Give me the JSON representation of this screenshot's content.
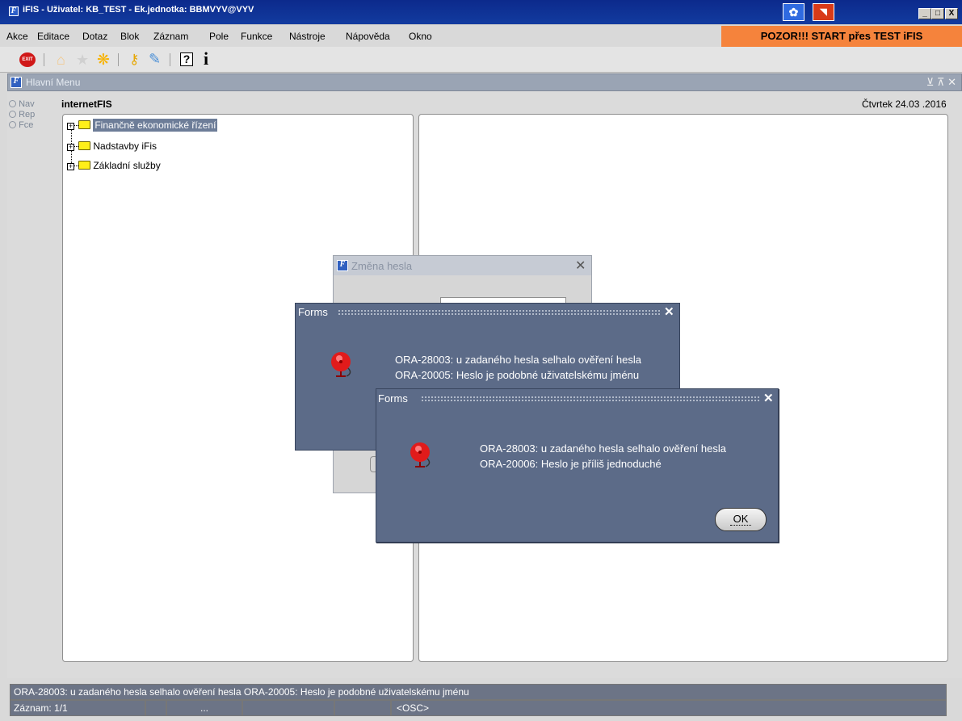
{
  "window": {
    "title": "iFIS - Uživatel: KB_TEST - Ek.jednotka: BBMVYV@VYV",
    "min": "_",
    "max": "□",
    "close": "X"
  },
  "menu": [
    "Akce",
    "Editace",
    "Dotaz",
    "Blok",
    "Záznam",
    "Pole",
    "Funkce",
    "Nástroje",
    "Nápověda",
    "Okno"
  ],
  "banner": "POZOR!!!  START přes TEST iFIS",
  "toolbar": {
    "exit_label": "EXIT",
    "help_glyph": "?",
    "info_glyph": "i"
  },
  "inner_window": {
    "title": "Hlavní Menu",
    "controls": "⊻ ⊼ ✕"
  },
  "radios": [
    "Nav",
    "Rep",
    "Fce"
  ],
  "app_name": "internetFIS",
  "date": "Čtvrtek 24.03 .2016",
  "tree": [
    "Finančně ekonomické řízení",
    "Nadstavby iFis",
    "Základní služby"
  ],
  "password_dialog": {
    "title": "Změna hesla",
    "close": "✕"
  },
  "dialog1": {
    "title": "Forms",
    "close": "✕",
    "line1": "ORA-28003: u zadaného hesla selhalo ověření hesla",
    "line2": "ORA-20005: Heslo je podobné uživatelskému jménu"
  },
  "dialog2": {
    "title": "Forms",
    "close": "✕",
    "line1": "ORA-28003: u zadaného hesla selhalo ověření hesla",
    "line2": "ORA-20006: Heslo je příliš jednoduché",
    "ok": "OK"
  },
  "status": {
    "message": "ORA-28003: u zadaného hesla selhalo ověření hesla ORA-20005: Heslo je podobné uživatelskému jménu",
    "record": "Záznam: 1/1",
    "f3": "...",
    "osc": "<OSC>"
  },
  "colors": {
    "title_bar": "#123b9f",
    "banner": "#f5833c",
    "dialog": "#5c6b88",
    "selection": "#6d7d98"
  }
}
